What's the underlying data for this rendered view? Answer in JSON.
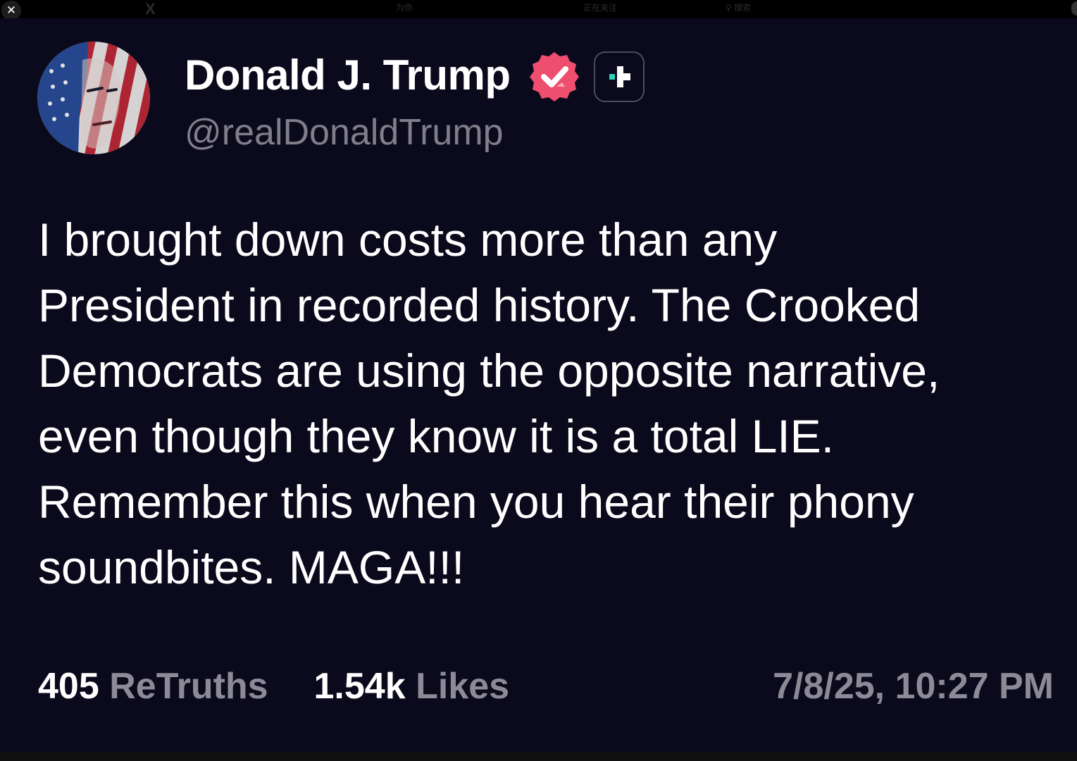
{
  "window": {
    "close_glyph": "✕",
    "logo": "X",
    "tabs": [
      "为你",
      "正在关注"
    ],
    "search_placeholder": "搜索"
  },
  "post": {
    "display_name": "Donald J. Trump",
    "handle": "@realDonaldTrump",
    "avatar_icon": "avatar-flag-portrait",
    "verified_icon": "verified-badge-icon",
    "plus_icon": "truth-plus-icon",
    "text": "I brought down costs more than any\nPresident in recorded history. The Crooked\nDemocrats are using the opposite narrative,\neven though they know it is a total LIE.\nRemember this when you hear their phony\nsoundbites. MAGA!!!",
    "retruths_count": "405",
    "retruths_label": "ReTruths",
    "likes_count": "1.54k",
    "likes_label": "Likes",
    "timestamp": "7/8/25, 10:27 PM"
  },
  "colors": {
    "background": "#0b0a1c",
    "text": "#ffffff",
    "muted": "#8b8a96",
    "verified": "#ee4f6e",
    "plus_accent": "#2ed3b7"
  }
}
